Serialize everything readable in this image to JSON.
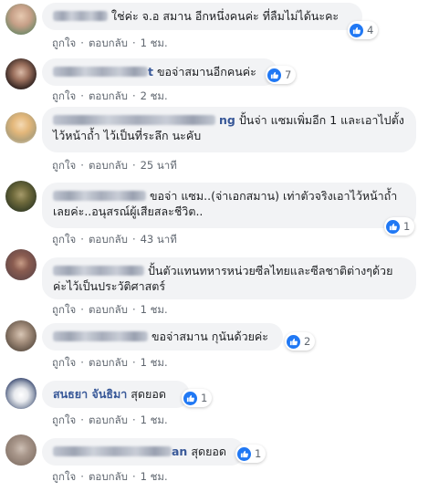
{
  "like_label": "ถูกใจ",
  "reply_label": "ตอบกลับ",
  "separator": "·",
  "comments": [
    {
      "text": "ใช่ค่ะ จ.อ สมาน อีกหนึ่งคนค่ะ ที่ลืมไม่ได้นะคะ",
      "reactions": "4",
      "time": "1 ชม."
    },
    {
      "name_suffix": "t",
      "text": "ขอจ่าสมานอีกคนค่ะ",
      "reactions": "7",
      "time": "2 ชม."
    },
    {
      "name_tail": "ng",
      "text": "ปั้นจ่า แซมเพิ่มอีก 1 และเอาไปตั้งไว้หน้าถ้ำ ไว้เป็นที่ระลึก นะคับ",
      "time": "25 นาที"
    },
    {
      "text": "ขอจ่า แซม..(จ่าเอกสมาน) เท่าตัวจริงเอาไว้หน้าถ้ำเลยค่ะ..อนุสรณ์ผู้เสียสละชีวิต..",
      "reactions": "1",
      "time": "43 นาที"
    },
    {
      "text": "ปั้นตัวแทนทหารหน่วยซีลไทยและซีลชาติต่างๆด้วยค่ะไว้เป็นประวัติศาสตร์",
      "time": "1 ชม."
    },
    {
      "text": "ขอจ่าสมาน กุนันด้วยค่ะ",
      "reactions": "2",
      "time": "1 ชม."
    },
    {
      "name": "สนธยา จันธิมา",
      "text": "สุดยอด",
      "reactions": "1",
      "time": "1 ชม."
    },
    {
      "name_suffix": "an",
      "text": "สุดยอด",
      "reactions": "1",
      "time": "1 ชม."
    }
  ]
}
